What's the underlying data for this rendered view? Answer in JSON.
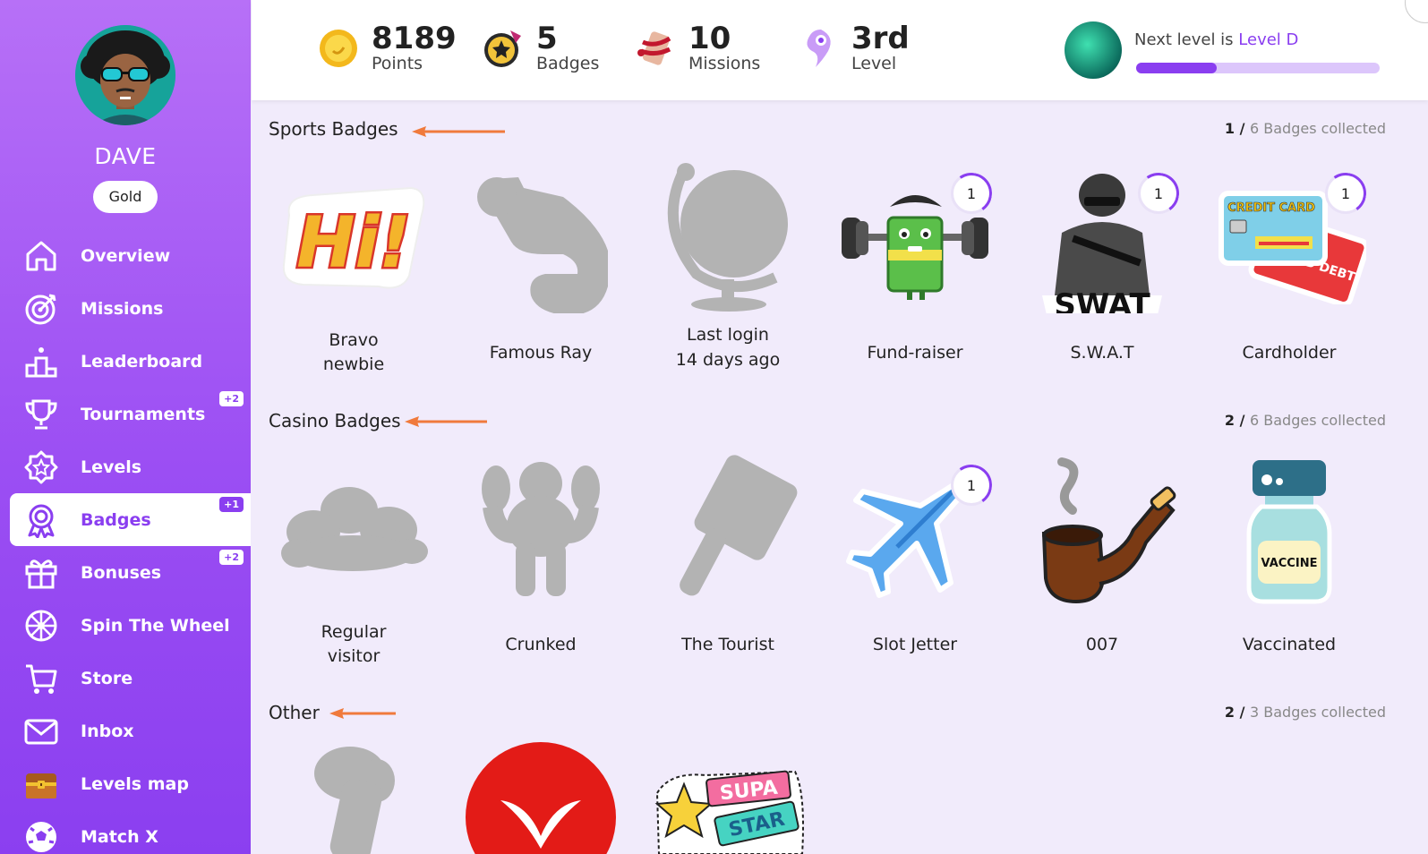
{
  "user": {
    "name": "DAVE",
    "tier": "Gold"
  },
  "nav": [
    {
      "label": "Overview",
      "icon": "home-icon"
    },
    {
      "label": "Missions",
      "icon": "target-icon"
    },
    {
      "label": "Leaderboard",
      "icon": "podium-icon"
    },
    {
      "label": "Tournaments",
      "icon": "trophy-icon",
      "badge": "+2"
    },
    {
      "label": "Levels",
      "icon": "star-badge-icon"
    },
    {
      "label": "Badges",
      "icon": "ribbon-icon",
      "badge": "+1",
      "active": true
    },
    {
      "label": "Bonuses",
      "icon": "gift-icon",
      "badge": "+2"
    },
    {
      "label": "Spin The Wheel",
      "icon": "wheel-icon"
    },
    {
      "label": "Store",
      "icon": "cart-icon"
    },
    {
      "label": "Inbox",
      "icon": "mail-icon"
    },
    {
      "label": "Levels map",
      "icon": "chest-icon"
    },
    {
      "label": "Match X",
      "icon": "ball-icon"
    }
  ],
  "stats": {
    "points": {
      "value": "8189",
      "label": "Points"
    },
    "badges": {
      "value": "5",
      "label": "Badges"
    },
    "missions": {
      "value": "10",
      "label": "Missions"
    },
    "level": {
      "value": "3rd",
      "label": "Level"
    }
  },
  "next_level": {
    "prefix": "Next level is",
    "name": "Level D",
    "progress": 0.33
  },
  "sections": {
    "sports": {
      "title": "Sports Badges",
      "collected": "1 /",
      "total": "6 Badges collected",
      "badges": [
        {
          "name1": "Bravo",
          "name2": "newbie"
        },
        {
          "name1": "Famous Ray",
          "name2": ""
        },
        {
          "name1": "Last login",
          "name2": "14 days ago"
        },
        {
          "name1": "Fund-raiser",
          "name2": "",
          "count": "1"
        },
        {
          "name1": "S.W.A.T",
          "name2": "",
          "count": "1"
        },
        {
          "name1": "Cardholder",
          "name2": "",
          "count": "1"
        }
      ]
    },
    "casino": {
      "title": "Casino Badges",
      "collected": "2 /",
      "total": "6 Badges collected",
      "badges": [
        {
          "name1": "Regular",
          "name2": "visitor"
        },
        {
          "name1": "Crunked",
          "name2": ""
        },
        {
          "name1": "The Tourist",
          "name2": ""
        },
        {
          "name1": "Slot Jetter",
          "name2": "",
          "count": "1"
        },
        {
          "name1": "007",
          "name2": ""
        },
        {
          "name1": "Vaccinated",
          "name2": ""
        }
      ]
    },
    "other": {
      "title": "Other",
      "collected": "2 /",
      "total": "3 Badges collected"
    }
  },
  "art_text": {
    "hi": "Hi!",
    "swat": "SWAT",
    "credit": "CREDIT CARD",
    "bad_debt": "BAD DEBT",
    "vaccine": "VACCINE",
    "supa": "SUPA",
    "star": "STAR"
  },
  "colors": {
    "accent": "#8a3ef0",
    "arrow": "#f07a3c",
    "locked": "#b3b3b3"
  }
}
